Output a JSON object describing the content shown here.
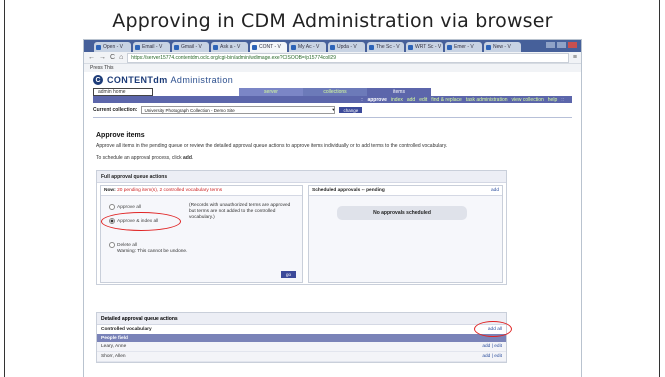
{
  "slide": {
    "title": "Approving in CDM Administration via browser"
  },
  "browser": {
    "tabs": [
      "Open - V",
      "Email - V",
      "Gmail - V",
      "Ask a - V",
      "CONT - V",
      "My Ac - V",
      "Upda - V",
      "The Sc - V",
      "WRT Sc - V",
      "Emer - V",
      "New - V"
    ],
    "back": "←",
    "forward": "→",
    "reload": "C",
    "home": "⌂",
    "url": "https://server15774.contentdm.oclc.org/cgi-bin/admin/wdimage.exe?CISOOB=/p15774coll29",
    "bookmark": "Press This"
  },
  "cdm": {
    "logo": "C",
    "title_bold": "CONTENTdm",
    "title_light": "Administration",
    "main_tabs": {
      "home": "admin home",
      "server": "server",
      "collections": "collections",
      "items": "items"
    },
    "subnav": [
      "approve",
      "index",
      "add",
      "edit",
      "find & replace",
      "task administration",
      "view collection",
      "help"
    ],
    "current_collection_label": "Current collection:",
    "current_collection_value": "University Photograph Collection - Demo Site",
    "change_button": "change"
  },
  "content": {
    "heading": "Approve items",
    "intro": "Approve all items in the pending queue or review the detailed approval queue actions to approve items individually or to add terms to the controlled vocabulary.",
    "schedule_prefix": "To schedule an approval process, click ",
    "schedule_link": "add",
    "full_queue": {
      "title": "Full approval queue actions",
      "now_label": "Now:",
      "pending": "20 pending item(s), 2 controlled vocabulary terms",
      "options": {
        "approve_all": "Approve all",
        "approve_index": "Approve & index all",
        "delete_all": "Delete all"
      },
      "desc": "(Records with unauthorized terms are approved but terms are not added to the controlled vocabulary.)",
      "warning": "Warning: This cannot be undone.",
      "go_button": "go",
      "scheduled_title": "Scheduled approvals -- pending",
      "scheduled_add": "add",
      "no_scheduled": "No approvals scheduled"
    },
    "detailed": {
      "title": "Detailed approval queue actions",
      "cv_label": "Controlled vocabulary",
      "add_all": "add all",
      "people_field": "People field",
      "rows": [
        {
          "name": "Leary, Anne",
          "actions": "add | edit"
        },
        {
          "name": "Shorr, Allen",
          "actions": "add | edit"
        }
      ]
    }
  }
}
